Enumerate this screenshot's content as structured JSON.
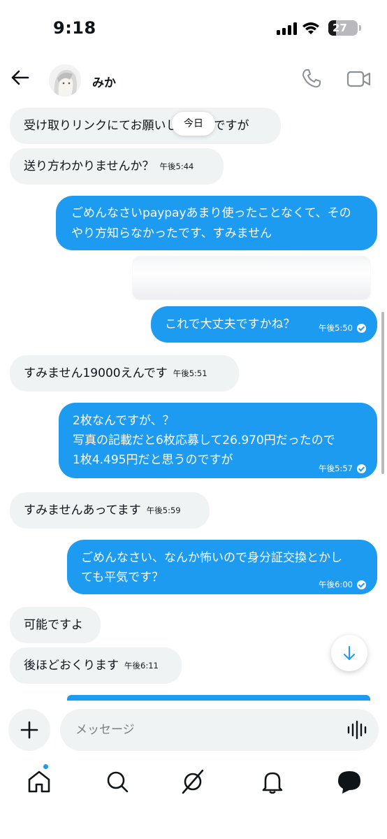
{
  "status_bar": {
    "time": "9:18",
    "battery": "27",
    "battery_level": 0.27
  },
  "header": {
    "contact_name": "みか"
  },
  "date_divider": "今日",
  "messages": [
    {
      "text": "受け取りリンクにてお願いしたいのですが",
      "time": ""
    },
    {
      "text": "送り方わかりませんか？",
      "time": "午後5:44"
    },
    {
      "text": "ごめんなさいpaypayあまり使ったことなくて、そのやり方知らなかったです、すみません",
      "time": ""
    },
    {
      "text": "これで大丈夫ですかね？",
      "time": "午後5:50"
    },
    {
      "text": "すみません19000えんです",
      "time": "午後5:51"
    },
    {
      "line1": "2枚なんですが、？",
      "line2": "写真の記載だと6枚応募して26.970円だったので",
      "line3": "1枚4.495円だと思うのですが",
      "time": "午後5:57"
    },
    {
      "text": "すみませんあってます",
      "time": "午後5:59"
    },
    {
      "line1": "ごめんなさい、なんか怖いので身分証交換とかし",
      "line2": "ても平気です？",
      "time": "午後6:00"
    },
    {
      "text": "可能ですよ",
      "time": ""
    },
    {
      "text": "後ほどおくります",
      "time": "午後6:11"
    }
  ],
  "composer": {
    "placeholder": "メッセージ"
  },
  "icons": {
    "back": "back-arrow-icon",
    "call": "phone-icon",
    "video": "video-icon",
    "add": "plus-icon",
    "voice": "waveform-icon",
    "scroll": "arrow-down-icon",
    "nav": [
      "home-icon",
      "search-icon",
      "grok-icon",
      "bell-icon",
      "messages-icon"
    ]
  },
  "colors": {
    "accent": "#1d9bf0",
    "incoming_bubble": "#eff3f4",
    "text": "#0f1419"
  }
}
